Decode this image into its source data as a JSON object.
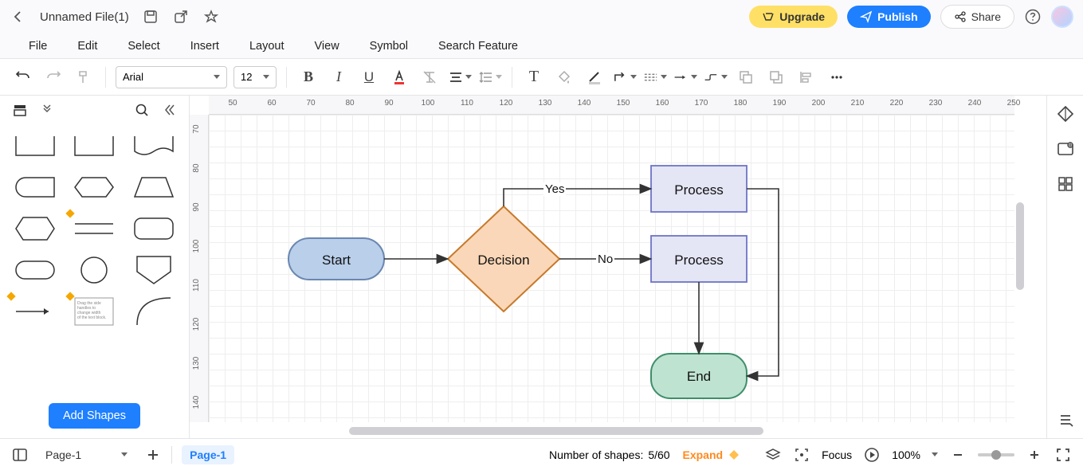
{
  "title": "Unnamed File(1)",
  "buttons": {
    "upgrade": "Upgrade",
    "publish": "Publish",
    "share": "Share"
  },
  "menu": [
    "File",
    "Edit",
    "Select",
    "Insert",
    "Layout",
    "View",
    "Symbol",
    "Search Feature"
  ],
  "toolbar": {
    "font": "Arial",
    "size": "12"
  },
  "sidebar": {
    "add_shapes": "Add Shapes"
  },
  "ruler": {
    "h": [
      "50",
      "60",
      "70",
      "80",
      "90",
      "100",
      "110",
      "120",
      "130",
      "140",
      "150",
      "160",
      "170",
      "180",
      "190",
      "200",
      "210",
      "220",
      "230",
      "240",
      "250"
    ],
    "v": [
      "70",
      "80",
      "90",
      "100",
      "110",
      "120",
      "130",
      "140"
    ]
  },
  "diagram": {
    "nodes": {
      "start": "Start",
      "decision": "Decision",
      "process1": "Process",
      "process2": "Process",
      "end": "End"
    },
    "edge_labels": {
      "yes": "Yes",
      "no": "No"
    }
  },
  "status": {
    "page_dd": "Page-1",
    "page_tab": "Page-1",
    "shapes_label": "Number of shapes: ",
    "shapes_count": "5/60",
    "expand": "Expand",
    "focus": "Focus",
    "zoom": "100%"
  }
}
